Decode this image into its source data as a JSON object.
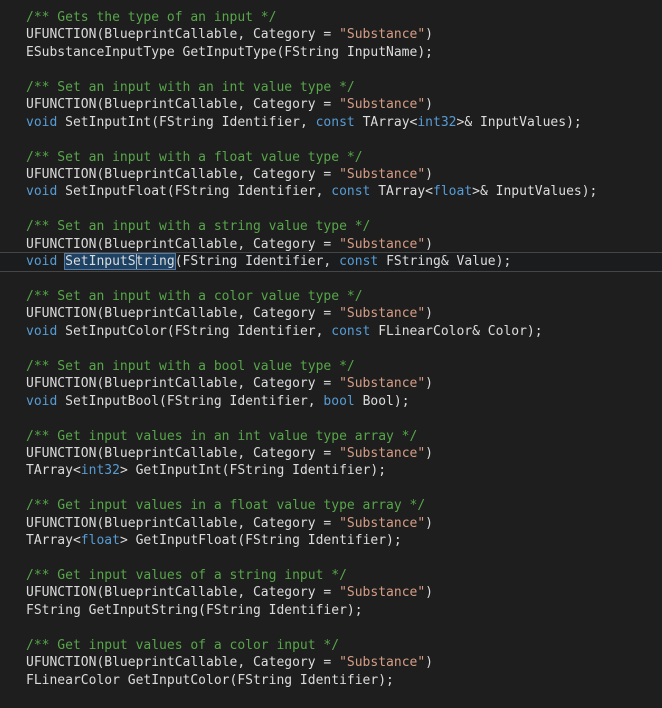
{
  "editor": {
    "language": "cpp",
    "colors": {
      "background": "#1e1e1e",
      "comment": "#57a64a",
      "keyword": "#569cd6",
      "plain": "#dcdcdc",
      "string": "#d69d85",
      "current_line_border": "#464646",
      "current_line_bg": "#1b1c1d",
      "selection_bg": "#1d4263",
      "selection_border": "#5878a0",
      "caret": "#a8b6c4"
    },
    "selected_symbol": "SetInputString",
    "lines": [
      {
        "tokens": [
          {
            "t": "c",
            "x": "/** Gets the type of an input */"
          }
        ]
      },
      {
        "tokens": [
          {
            "t": "p",
            "x": "UFUNCTION(BlueprintCallable, Category = "
          },
          {
            "t": "s",
            "x": "\"Substance\""
          },
          {
            "t": "p",
            "x": ")"
          }
        ]
      },
      {
        "tokens": [
          {
            "t": "p",
            "x": "ESubstanceInputType GetInputType(FString InputName);"
          }
        ]
      },
      {
        "tokens": []
      },
      {
        "tokens": [
          {
            "t": "c",
            "x": "/** Set an input with an int value type */"
          }
        ]
      },
      {
        "tokens": [
          {
            "t": "p",
            "x": "UFUNCTION(BlueprintCallable, Category = "
          },
          {
            "t": "s",
            "x": "\"Substance\""
          },
          {
            "t": "p",
            "x": ")"
          }
        ]
      },
      {
        "tokens": [
          {
            "t": "k",
            "x": "void "
          },
          {
            "t": "p",
            "x": "SetInputInt(FString Identifier, "
          },
          {
            "t": "k",
            "x": "const "
          },
          {
            "t": "p",
            "x": "TArray<"
          },
          {
            "t": "k",
            "x": "int32"
          },
          {
            "t": "p",
            "x": ">& InputValues);"
          }
        ]
      },
      {
        "tokens": []
      },
      {
        "tokens": [
          {
            "t": "c",
            "x": "/** Set an input with a float value type */"
          }
        ]
      },
      {
        "tokens": [
          {
            "t": "p",
            "x": "UFUNCTION(BlueprintCallable, Category = "
          },
          {
            "t": "s",
            "x": "\"Substance\""
          },
          {
            "t": "p",
            "x": ")"
          }
        ]
      },
      {
        "tokens": [
          {
            "t": "k",
            "x": "void "
          },
          {
            "t": "p",
            "x": "SetInputFloat(FString Identifier, "
          },
          {
            "t": "k",
            "x": "const "
          },
          {
            "t": "p",
            "x": "TArray<"
          },
          {
            "t": "k",
            "x": "float"
          },
          {
            "t": "p",
            "x": ">& InputValues);"
          }
        ]
      },
      {
        "tokens": []
      },
      {
        "tokens": [
          {
            "t": "c",
            "x": "/** Set an input with a string value type */"
          }
        ]
      },
      {
        "tokens": [
          {
            "t": "p",
            "x": "UFUNCTION(BlueprintCallable, Category = "
          },
          {
            "t": "s",
            "x": "\"Substance\""
          },
          {
            "t": "p",
            "x": ")"
          }
        ]
      },
      {
        "current": true,
        "tokens": [
          {
            "t": "k",
            "x": "void "
          },
          {
            "t": "p",
            "x": "SetInputString",
            "sel": true,
            "caret": 9
          },
          {
            "t": "p",
            "x": "(FString Identifier, "
          },
          {
            "t": "k",
            "x": "const "
          },
          {
            "t": "p",
            "x": "FString& Value);"
          }
        ]
      },
      {
        "tokens": []
      },
      {
        "tokens": [
          {
            "t": "c",
            "x": "/** Set an input with a color value type */"
          }
        ]
      },
      {
        "tokens": [
          {
            "t": "p",
            "x": "UFUNCTION(BlueprintCallable, Category = "
          },
          {
            "t": "s",
            "x": "\"Substance\""
          },
          {
            "t": "p",
            "x": ")"
          }
        ]
      },
      {
        "tokens": [
          {
            "t": "k",
            "x": "void "
          },
          {
            "t": "p",
            "x": "SetInputColor(FString Identifier, "
          },
          {
            "t": "k",
            "x": "const "
          },
          {
            "t": "p",
            "x": "FLinearColor& Color);"
          }
        ]
      },
      {
        "tokens": []
      },
      {
        "tokens": [
          {
            "t": "c",
            "x": "/** Set an input with a bool value type */"
          }
        ]
      },
      {
        "tokens": [
          {
            "t": "p",
            "x": "UFUNCTION(BlueprintCallable, Category = "
          },
          {
            "t": "s",
            "x": "\"Substance\""
          },
          {
            "t": "p",
            "x": ")"
          }
        ]
      },
      {
        "tokens": [
          {
            "t": "k",
            "x": "void "
          },
          {
            "t": "p",
            "x": "SetInputBool(FString Identifier, "
          },
          {
            "t": "k",
            "x": "bool "
          },
          {
            "t": "p",
            "x": "Bool);"
          }
        ]
      },
      {
        "tokens": []
      },
      {
        "tokens": [
          {
            "t": "c",
            "x": "/** Get input values in an int value type array */"
          }
        ]
      },
      {
        "tokens": [
          {
            "t": "p",
            "x": "UFUNCTION(BlueprintCallable, Category = "
          },
          {
            "t": "s",
            "x": "\"Substance\""
          },
          {
            "t": "p",
            "x": ")"
          }
        ]
      },
      {
        "tokens": [
          {
            "t": "p",
            "x": "TArray<"
          },
          {
            "t": "k",
            "x": "int32"
          },
          {
            "t": "p",
            "x": "> GetInputInt(FString Identifier);"
          }
        ]
      },
      {
        "tokens": []
      },
      {
        "tokens": [
          {
            "t": "c",
            "x": "/** Get input values in a float value type array */"
          }
        ]
      },
      {
        "tokens": [
          {
            "t": "p",
            "x": "UFUNCTION(BlueprintCallable, Category = "
          },
          {
            "t": "s",
            "x": "\"Substance\""
          },
          {
            "t": "p",
            "x": ")"
          }
        ]
      },
      {
        "tokens": [
          {
            "t": "p",
            "x": "TArray<"
          },
          {
            "t": "k",
            "x": "float"
          },
          {
            "t": "p",
            "x": "> GetInputFloat(FString Identifier);"
          }
        ]
      },
      {
        "tokens": []
      },
      {
        "tokens": [
          {
            "t": "c",
            "x": "/** Get input values of a string input */"
          }
        ]
      },
      {
        "tokens": [
          {
            "t": "p",
            "x": "UFUNCTION(BlueprintCallable, Category = "
          },
          {
            "t": "s",
            "x": "\"Substance\""
          },
          {
            "t": "p",
            "x": ")"
          }
        ]
      },
      {
        "tokens": [
          {
            "t": "p",
            "x": "FString GetInputString(FString Identifier);"
          }
        ]
      },
      {
        "tokens": []
      },
      {
        "tokens": [
          {
            "t": "c",
            "x": "/** Get input values of a color input */"
          }
        ]
      },
      {
        "tokens": [
          {
            "t": "p",
            "x": "UFUNCTION(BlueprintCallable, Category = "
          },
          {
            "t": "s",
            "x": "\"Substance\""
          },
          {
            "t": "p",
            "x": ")"
          }
        ]
      },
      {
        "tokens": [
          {
            "t": "p",
            "x": "FLinearColor GetInputColor(FString Identifier);"
          }
        ]
      }
    ]
  }
}
